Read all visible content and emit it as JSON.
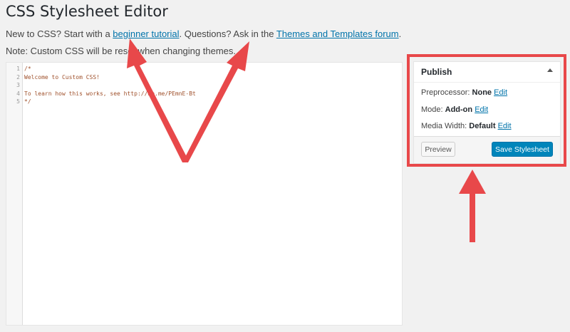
{
  "page": {
    "title": "CSS Stylesheet Editor"
  },
  "intro": {
    "prefix": "New to CSS? Start with a ",
    "tutorial_link": "beginner tutorial",
    "middle": ". Questions? Ask in the ",
    "forum_link": "Themes and Templates forum",
    "suffix": "."
  },
  "note": "Note: Custom CSS will be reset when changing themes.",
  "editor": {
    "line_numbers": [
      "1",
      "2",
      "3",
      "4",
      "5"
    ],
    "lines": [
      "/*",
      "Welcome to Custom CSS!",
      "",
      "To learn how this works, see http://wp.me/PEmnE-Bt",
      "*/"
    ]
  },
  "publish": {
    "title": "Publish",
    "toggle_icon": "triangle-up-icon",
    "preprocessor_label": "Preprocessor: ",
    "preprocessor_value": "None",
    "mode_label": "Mode: ",
    "mode_value": "Add-on",
    "media_width_label": "Media Width: ",
    "media_width_value": "Default",
    "edit_label": "Edit",
    "preview_button": "Preview",
    "save_button": "Save Stylesheet"
  },
  "annotations": {
    "color": "#e8484a"
  }
}
